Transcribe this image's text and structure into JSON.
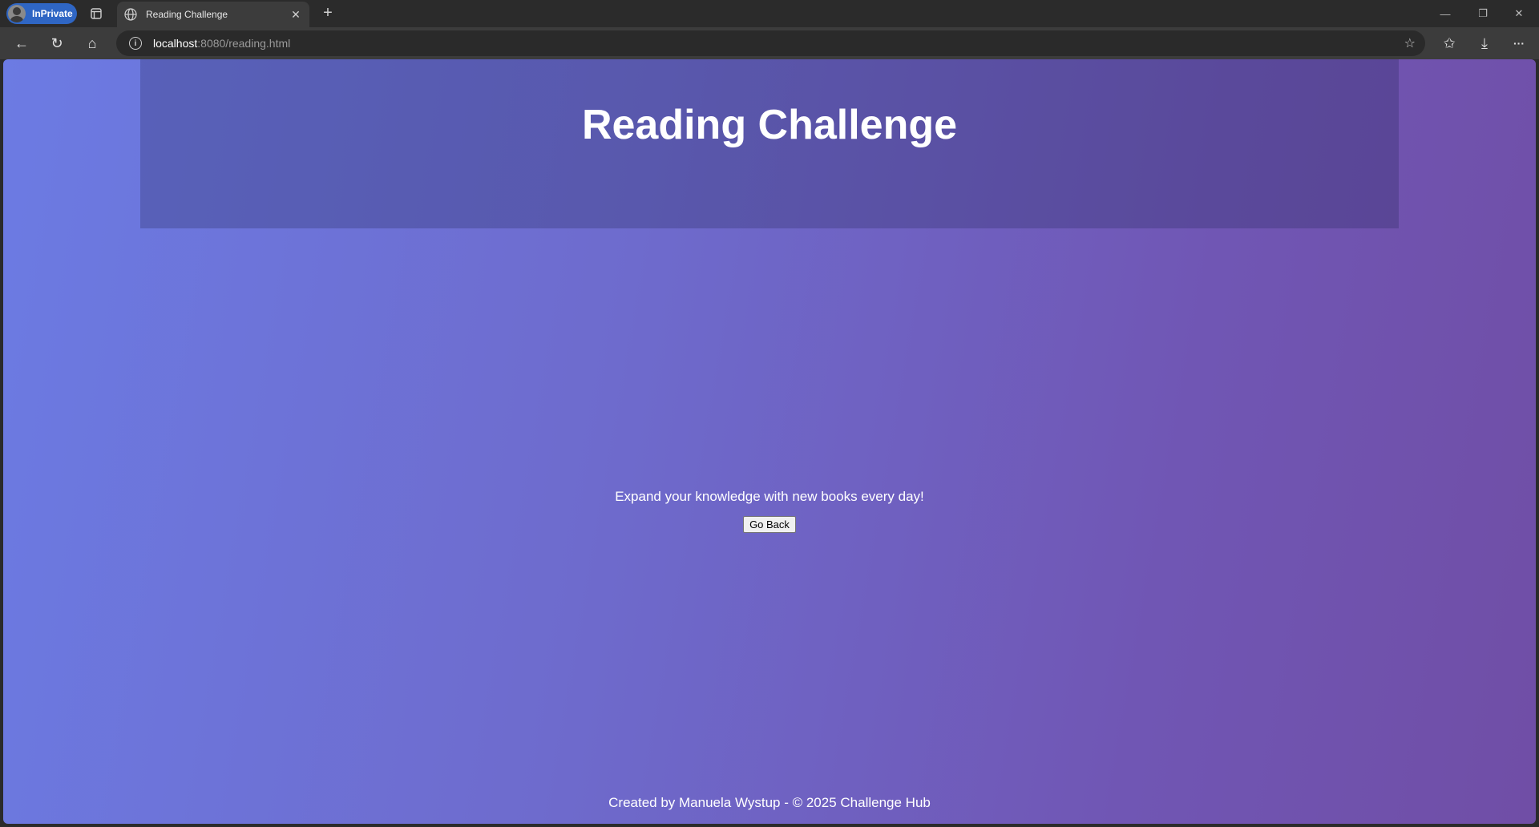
{
  "browser": {
    "inprivate_label": "InPrivate",
    "tab_title": "Reading Challenge",
    "tab_close": "✕",
    "new_tab": "+",
    "url_host": "localhost",
    "url_rest": ":8080/reading.html",
    "info_icon": "i",
    "star_icon": "☆",
    "back_icon": "←",
    "reload_icon": "↻",
    "home_icon": "⌂",
    "favorites_icon": "✩",
    "download_icon": "⤓",
    "more_icon": "···",
    "minimize_icon": "—",
    "restore_icon": "❐",
    "close_icon": "✕"
  },
  "page": {
    "title": "Reading Challenge",
    "description": "Expand your knowledge with new books every day!",
    "back_button": "Go Back",
    "footer": "Created by Manuela Wystup - © 2025 Challenge Hub"
  },
  "colors": {
    "gradient_start": "#6c7be3",
    "gradient_end": "#704ea6",
    "text": "#ffffff"
  }
}
